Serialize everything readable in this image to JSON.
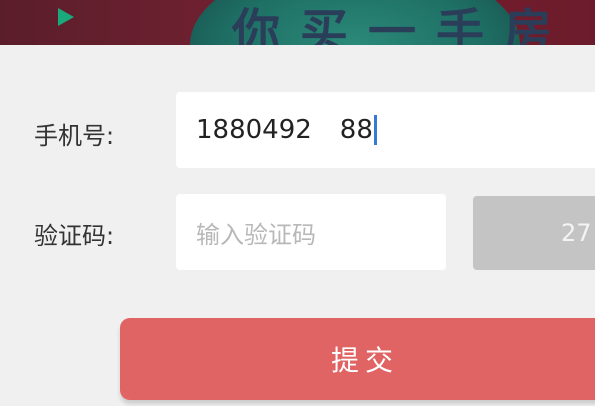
{
  "banner": {
    "text": "你买一手房"
  },
  "form": {
    "phone_label": "手机号:",
    "phone_value_part1": "1880492",
    "phone_value_part2": "88",
    "code_label": "验证码:",
    "code_placeholder": "输入验证码",
    "code_button_label": "27",
    "submit_label": "提交"
  },
  "colors": {
    "submit_bg": "#e06464",
    "code_button_bg": "#c4c4c4",
    "caret": "#3a78d8"
  }
}
